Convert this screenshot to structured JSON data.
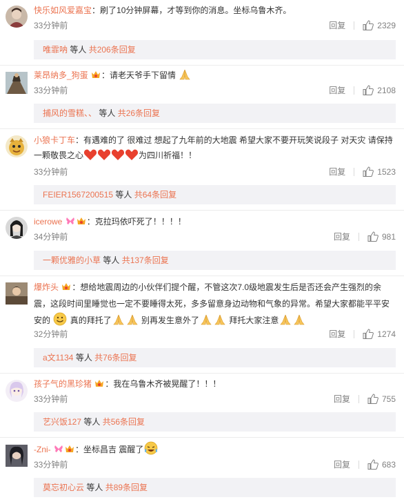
{
  "comments": [
    {
      "user": "快乐如风爱嘉宝",
      "text_parts": [
        "：刷了10分钟屏幕，才等到你的消息。坐标乌鲁木齐。"
      ],
      "time": "33分钟前",
      "reply_label": "回复",
      "likes": "2329",
      "reply_name": "唯霏呐",
      "reply_mid": " 等人 ",
      "reply_count": "共206条回复"
    },
    {
      "user": "莱昂纳多_狗蛋",
      "text_parts": [
        "：请老天爷手下留情"
      ],
      "time": "33分钟前",
      "reply_label": "回复",
      "likes": "2108",
      "reply_name": "捕风的雪糕、、",
      "reply_mid": " 等人 ",
      "reply_count": "共26条回复"
    },
    {
      "user": "小狼卡丁车",
      "text_parts": [
        "：有遇难的了 很难过 想起了九年前的大地震 希望大家不要开玩笑说段子 对天灾 请保持一颗敬畏之心",
        "为四川祈福！！"
      ],
      "time": "33分钟前",
      "reply_label": "回复",
      "likes": "1523",
      "reply_name": "FEIER1567200515",
      "reply_mid": " 等人 ",
      "reply_count": "共64条回复"
    },
    {
      "user": "icerowe",
      "text_parts": [
        "：克拉玛依吓死了！！！！"
      ],
      "time": "34分钟前",
      "reply_label": "回复",
      "likes": "981",
      "reply_name": "一颗优雅的小草",
      "reply_mid": " 等人 ",
      "reply_count": "共137条回复"
    },
    {
      "user": "爆炸头",
      "text_parts": [
        "：想给地震周边的小伙伴们提个醒，不管这次7.0级地震发生后是否还会产生强烈的余震，这段时间里睡觉也一定不要睡得太死，多多留意身边动物和气象的异常。希望大家都能平平安安的",
        " 真的拜托了",
        " 别再发生意外了",
        " 拜托大家注意"
      ],
      "time": "32分钟前",
      "reply_label": "回复",
      "likes": "1274",
      "reply_name": "a文1134",
      "reply_mid": " 等人 ",
      "reply_count": "共76条回复"
    },
    {
      "user": "孩子气的黑珍猪",
      "text_parts": [
        "：我在乌鲁木齐被晃醒了！！！"
      ],
      "time": "33分钟前",
      "reply_label": "回复",
      "likes": "755",
      "reply_name": "艺兴饭127",
      "reply_mid": " 等人 ",
      "reply_count": "共56条回复"
    },
    {
      "user": "-Zni-",
      "text_parts": [
        "：坐标昌吉 震醒了"
      ],
      "time": "33分钟前",
      "reply_label": "回复",
      "likes": "683",
      "reply_name": "莫忘初心云",
      "reply_mid": " 等人 ",
      "reply_count": "共89条回复"
    }
  ],
  "colors": {
    "username": "#eb7350",
    "meta": "#808080",
    "reply_box_bg": "#f2f2f5"
  },
  "icons": [
    "thumb-up-icon",
    "vip-badge-icon",
    "praying-hands-emoji",
    "heart-emoji",
    "smiley-emoji",
    "laughing-tears-emoji"
  ]
}
